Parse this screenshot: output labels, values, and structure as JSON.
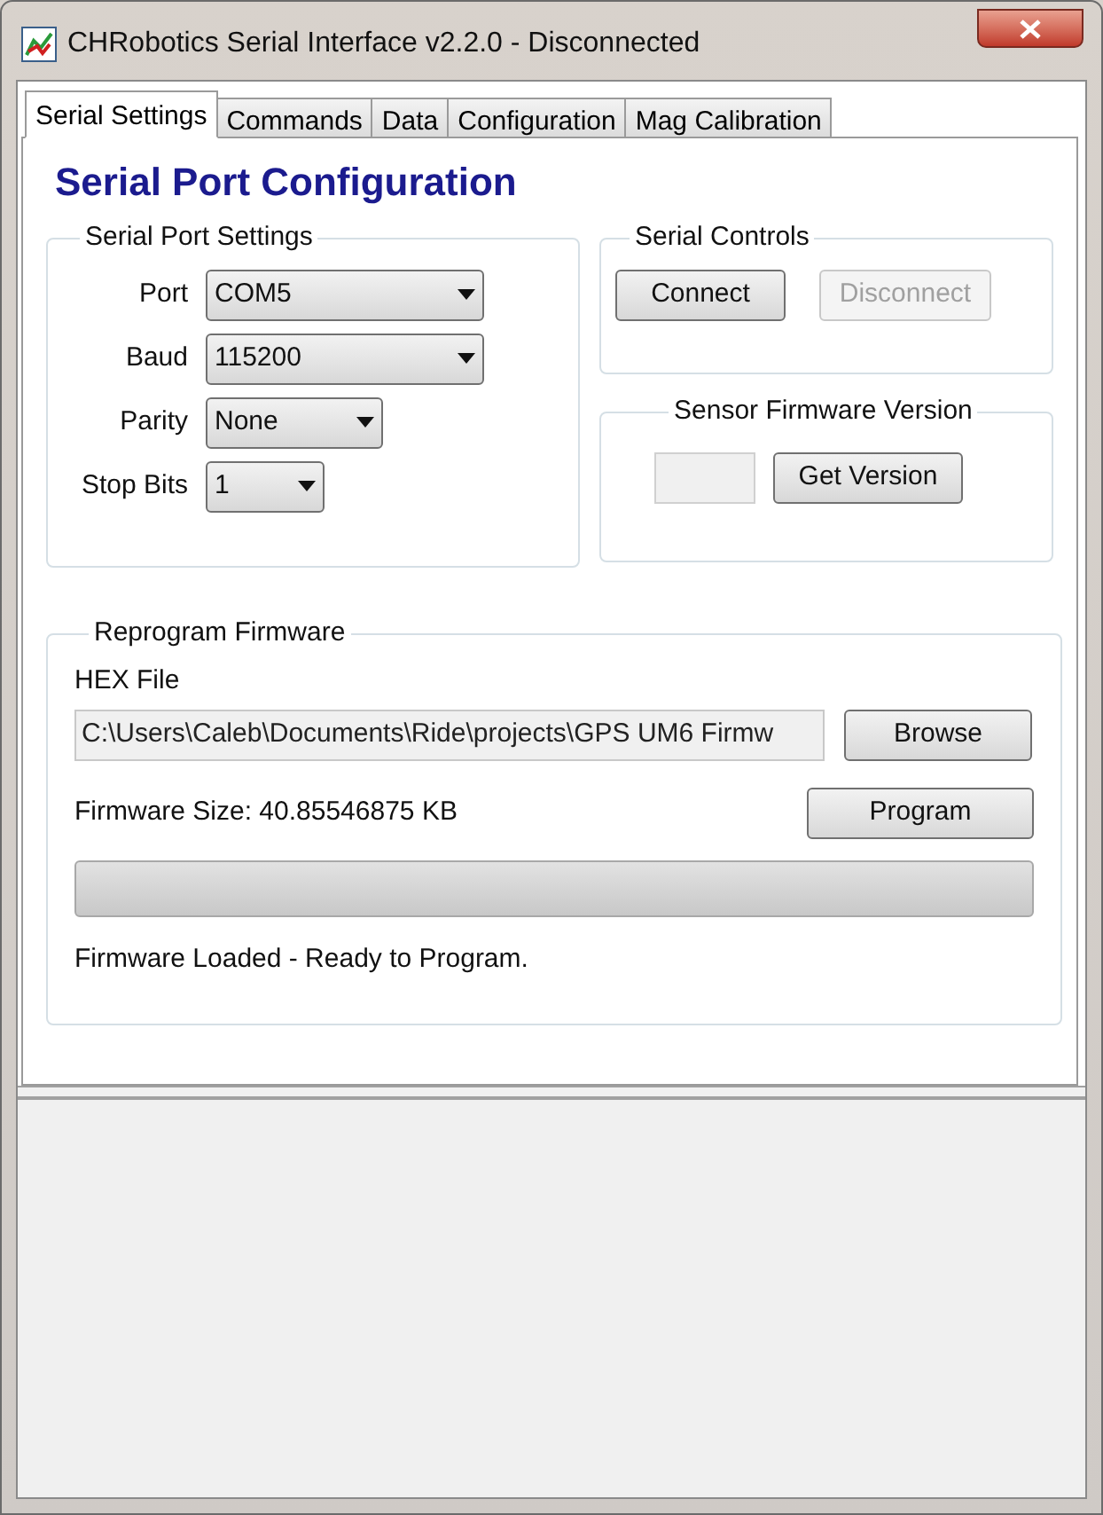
{
  "window": {
    "title": "CHRobotics Serial Interface v2.2.0 - Disconnected"
  },
  "tabs": [
    {
      "label": "Serial Settings",
      "selected": true
    },
    {
      "label": "Commands",
      "selected": false
    },
    {
      "label": "Data",
      "selected": false
    },
    {
      "label": "Configuration",
      "selected": false
    },
    {
      "label": "Mag Calibration",
      "selected": false
    }
  ],
  "heading": "Serial Port Configuration",
  "serial_port_settings": {
    "title": "Serial Port Settings",
    "fields": [
      {
        "label": "Port",
        "value": "COM5"
      },
      {
        "label": "Baud",
        "value": "115200"
      },
      {
        "label": "Parity",
        "value": "None"
      },
      {
        "label": "Stop Bits",
        "value": "1"
      }
    ]
  },
  "serial_controls": {
    "title": "Serial Controls",
    "buttons": [
      {
        "label": "Connect",
        "disabled": false
      },
      {
        "label": "Disconnect",
        "disabled": true
      }
    ]
  },
  "sensor_firmware_version": {
    "title": "Sensor Firmware Version",
    "button": {
      "label": "Get Version",
      "disabled": false
    }
  },
  "reprogram_firmware": {
    "title": "Reprogram Firmware",
    "hex_label": "HEX File",
    "hex_path": "C:\\Users\\Caleb\\Documents\\Ride\\projects\\GPS UM6 Firmw",
    "browse": "Browse",
    "size_text": "Firmware Size: 40.85546875 KB",
    "program": "Program",
    "progress": {
      "level": 0
    },
    "status": "Firmware Loaded - Ready to Program."
  }
}
